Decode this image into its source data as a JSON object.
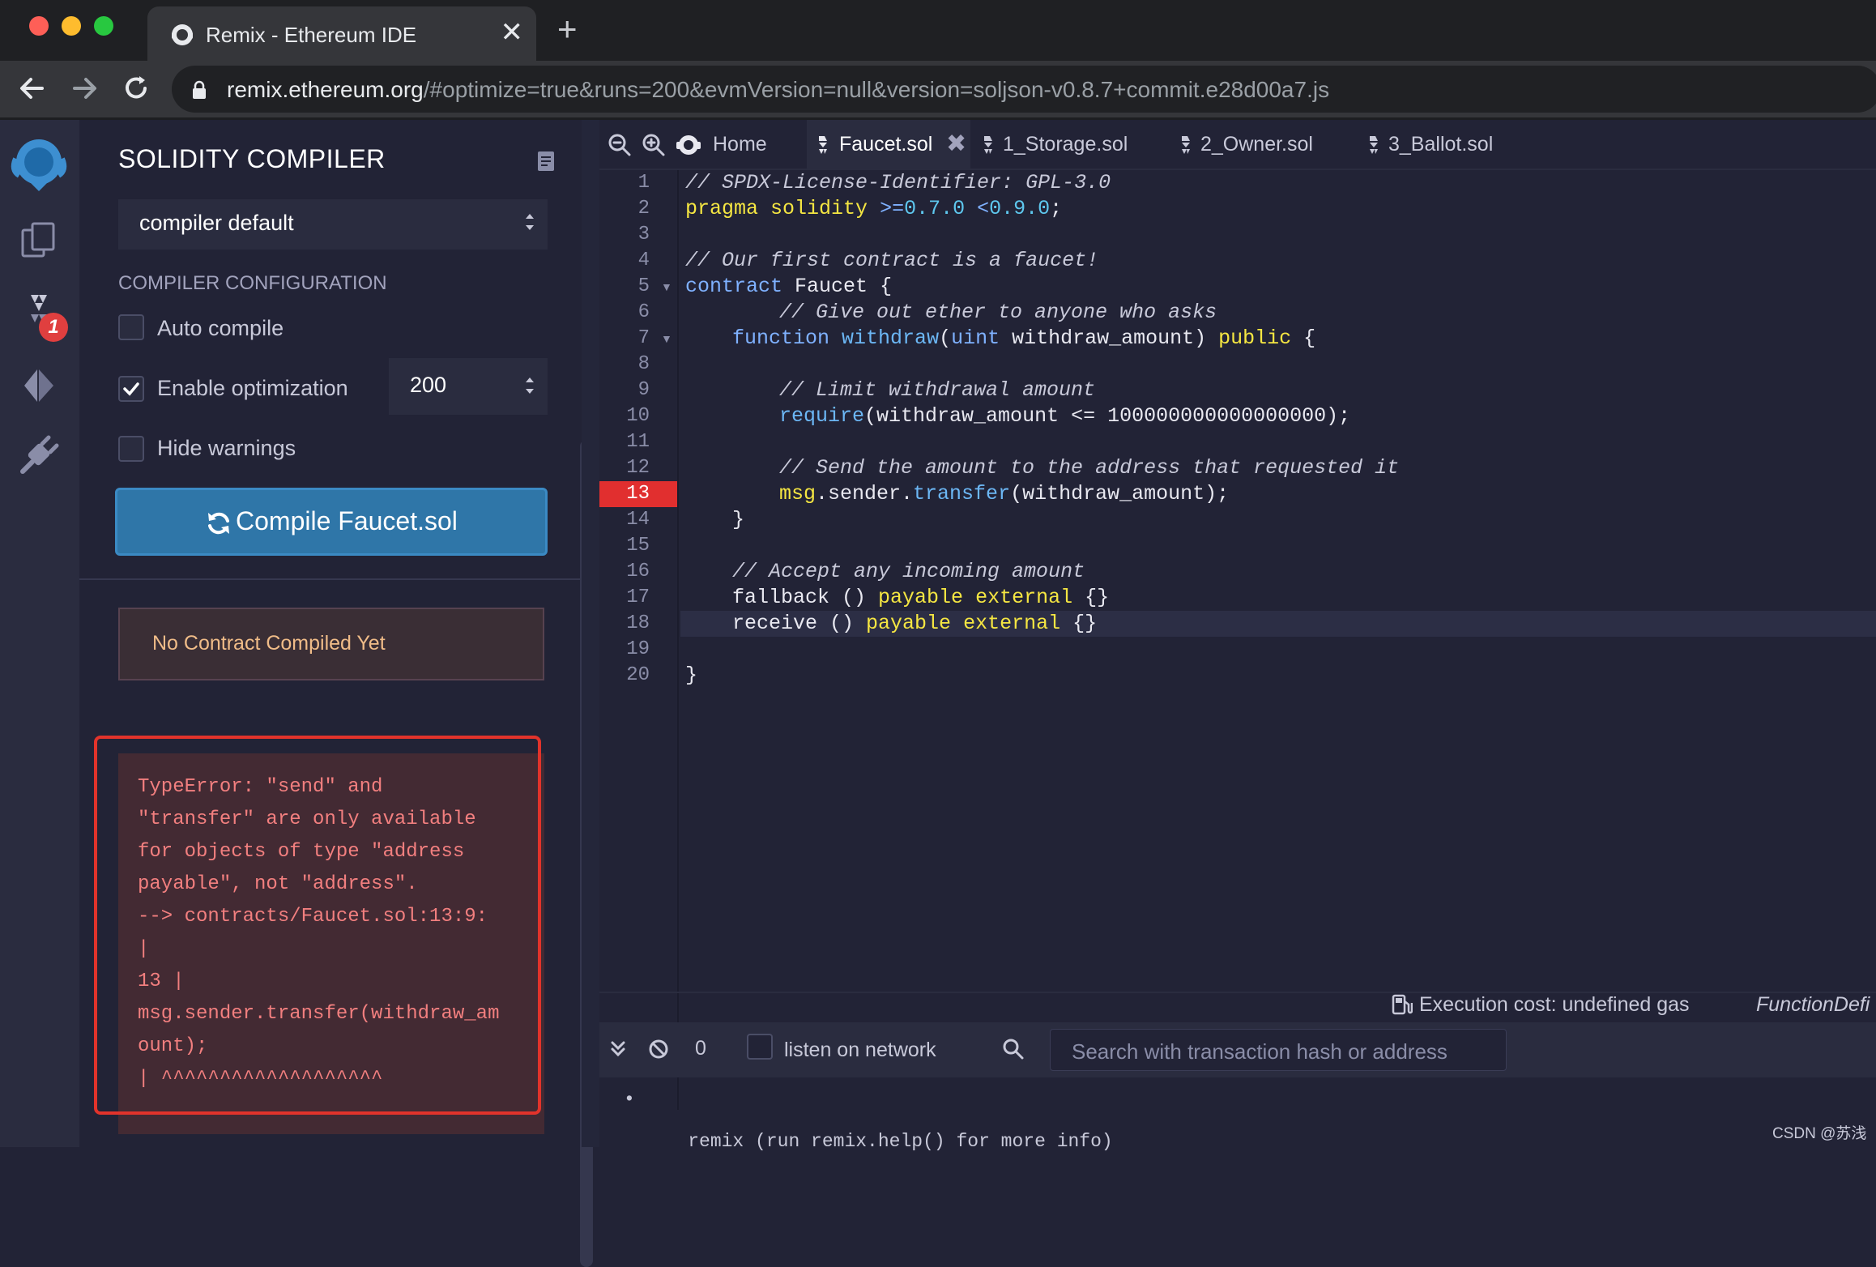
{
  "browser": {
    "tab_title": "Remix - Ethereum IDE",
    "tab_close": "✕",
    "new_tab": "+",
    "url_host": "remix.ethereum.org",
    "url_rest": "/#optimize=true&runs=200&evmVersion=null&version=soljson-v0.8.7+commit.e28d00a7.js"
  },
  "iconbar": {
    "badge": "1"
  },
  "sidepanel": {
    "title": "SOLIDITY COMPILER",
    "compiler_select": "compiler default",
    "config_label": "COMPILER CONFIGURATION",
    "auto_compile": "Auto compile",
    "enable_optimization": "Enable optimization",
    "runs_value": "200",
    "hide_warnings": "Hide warnings",
    "compile_button": "Compile Faucet.sol",
    "no_contract": "No Contract Compiled Yet",
    "error": "TypeError: \"send\" and\n\"transfer\" are only available\nfor objects of type \"address\npayable\", not \"address\".\n--> contracts/Faucet.sol:13:9:\n|\n13 |\nmsg.sender.transfer(withdraw_am\nount);\n| ^^^^^^^^^^^^^^^^^^^"
  },
  "editor": {
    "tabs": {
      "home": "Home",
      "faucet": "Faucet.sol",
      "storage": "1_Storage.sol",
      "owner": "2_Owner.sol",
      "ballot": "3_Ballot.sol"
    },
    "close_glyph": "✖",
    "line_numbers": [
      "1",
      "2",
      "3",
      "4",
      "5",
      "6",
      "7",
      "8",
      "9",
      "10",
      "11",
      "12",
      "13",
      "14",
      "15",
      "16",
      "17",
      "18",
      "19",
      "20"
    ],
    "error_line": "13",
    "current_line": "18",
    "code": {
      "l1": "// SPDX-License-Identifier: GPL-3.0",
      "l2a": "pragma",
      "l2b": "solidity",
      "l2c": ">=",
      "l2d": "0.7.0",
      "l2e": "<",
      "l2f": "0.9.0",
      "l2g": ";",
      "l4": "// Our first contract is a faucet!",
      "l5a": "contract",
      "l5b": "Faucet {",
      "l6": "// Give out ether to anyone who asks",
      "l7a": "function",
      "l7b": "withdraw",
      "l7c": "(",
      "l7d": "uint",
      "l7e": " withdraw_amount) ",
      "l7f": "public",
      "l7g": " {",
      "l9": "// Limit withdrawal amount",
      "l10a": "require",
      "l10b": "(withdraw_amount <= 100000000000000000);",
      "l12": "// Send the amount to the address that requested it",
      "l13a": "msg",
      "l13b": ".sender.",
      "l13c": "transfer",
      "l13d": "(withdraw_amount);",
      "l14": "}",
      "l16": "// Accept any incoming amount",
      "l17a": "fallback () ",
      "l17b": "payable",
      "l17c": " ",
      "l17d": "external",
      "l17e": " {}",
      "l18a": "receive () ",
      "l18b": "payable",
      "l18c": " ",
      "l18d": "external",
      "l18e": " {}",
      "l20": "}"
    }
  },
  "terminal": {
    "exec_cost": "Execution cost: undefined gas",
    "function_def": "FunctionDefi",
    "count": "0",
    "listen_label": "listen on network",
    "search_placeholder": "Search with transaction hash or address",
    "output": "remix (run remix.help() for more info)",
    "bullet": "•"
  },
  "watermark": "CSDN @苏浅",
  "colors": {
    "background": "#222336",
    "panel": "#2a2c3f",
    "primary": "#2f76a8",
    "error": "#e12f2f",
    "warning_text": "#f0bc88"
  }
}
